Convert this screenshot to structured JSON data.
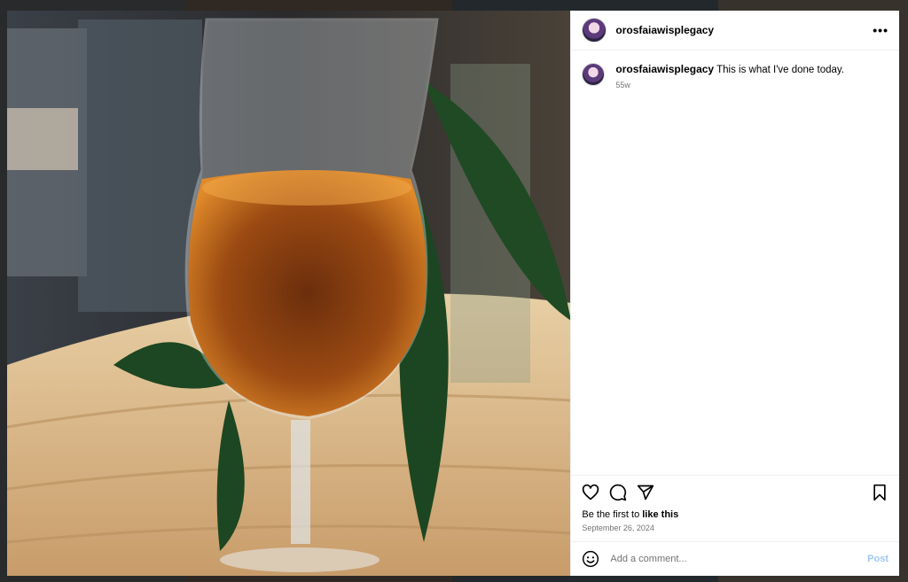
{
  "post": {
    "username": "orosfaiawisplegacy",
    "more_icon": "more-horizontal-icon",
    "caption": {
      "username": "orosfaiawisplegacy",
      "text": "This is what I've done today.",
      "time": "55w"
    },
    "actions": {
      "like_icon": "heart-icon",
      "comment_icon": "comment-icon",
      "share_icon": "share-icon",
      "save_icon": "bookmark-icon"
    },
    "likes_prefix": "Be the first to ",
    "likes_link": "like this",
    "date": "September 26, 2024",
    "comment_placeholder": "Add a comment...",
    "post_label": "Post"
  },
  "colors": {
    "post_button": "#9fc6f3",
    "muted_text": "#737373"
  }
}
